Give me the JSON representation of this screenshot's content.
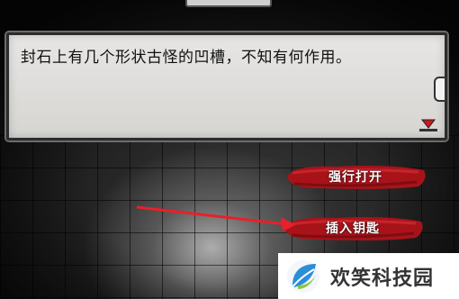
{
  "top_tab": {
    "label": ""
  },
  "dialog": {
    "text": "封石上有几个形状古怪的凹槽，不知有何作用。",
    "next_icon": "down-triangle-icon"
  },
  "choices": [
    {
      "label": "强行打开"
    },
    {
      "label": "插入钥匙"
    }
  ],
  "annotation": {
    "arrow_color": "#e8202a"
  },
  "watermark": {
    "text": "欢笑科技园",
    "logo": "leaf-logo"
  },
  "colors": {
    "choice_red": "#b3141b",
    "dialog_bg": "#e2e1de",
    "marker_red": "#d3161e"
  }
}
